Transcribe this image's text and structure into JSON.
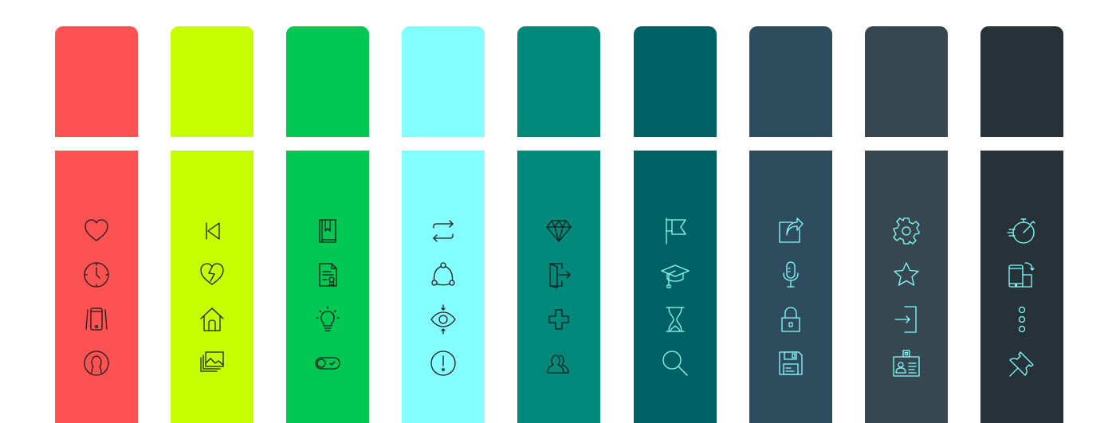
{
  "palette": [
    {
      "color": "#ff5252",
      "icon_color": "#1c1c1c",
      "icons": [
        "heart-icon",
        "clock-icon",
        "vibrating-phone-icon",
        "user-circle-icon"
      ]
    },
    {
      "color": "#c6ff00",
      "icon_color": "#1c1c1c",
      "icons": [
        "skip-back-icon",
        "broken-heart-icon",
        "home-icon",
        "image-stack-icon"
      ]
    },
    {
      "color": "#00c853",
      "icon_color": "#1c1c1c",
      "icons": [
        "bookmark-book-icon",
        "certificate-document-icon",
        "lightbulb-icon",
        "toggle-switch-icon"
      ]
    },
    {
      "color": "#84ffff",
      "icon_color": "#1c1c1c",
      "icons": [
        "repeat-icon",
        "share-nodes-icon",
        "eye-focus-icon",
        "alert-circle-icon"
      ]
    },
    {
      "color": "#00897b",
      "icon_color": "#1c1c1c",
      "icons": [
        "diamond-icon",
        "exit-door-icon",
        "plus-icon",
        "users-icon"
      ]
    },
    {
      "color": "#006064",
      "icon_color": "#84ffff",
      "icons": [
        "flag-icon",
        "graduation-cap-icon",
        "hourglass-icon",
        "search-icon"
      ]
    },
    {
      "color": "#2e4c5e",
      "icon_color": "#84ffff",
      "icons": [
        "share-external-icon",
        "microphone-icon",
        "lock-icon",
        "save-floppy-icon"
      ]
    },
    {
      "color": "#37474f",
      "icon_color": "#84ffff",
      "icons": [
        "gear-icon",
        "star-icon",
        "login-icon",
        "id-badge-icon"
      ]
    },
    {
      "color": "#263238",
      "icon_color": "#84ffff",
      "icons": [
        "fast-timer-icon",
        "phone-rotate-icon",
        "more-vertical-icon",
        "pin-icon"
      ]
    }
  ]
}
